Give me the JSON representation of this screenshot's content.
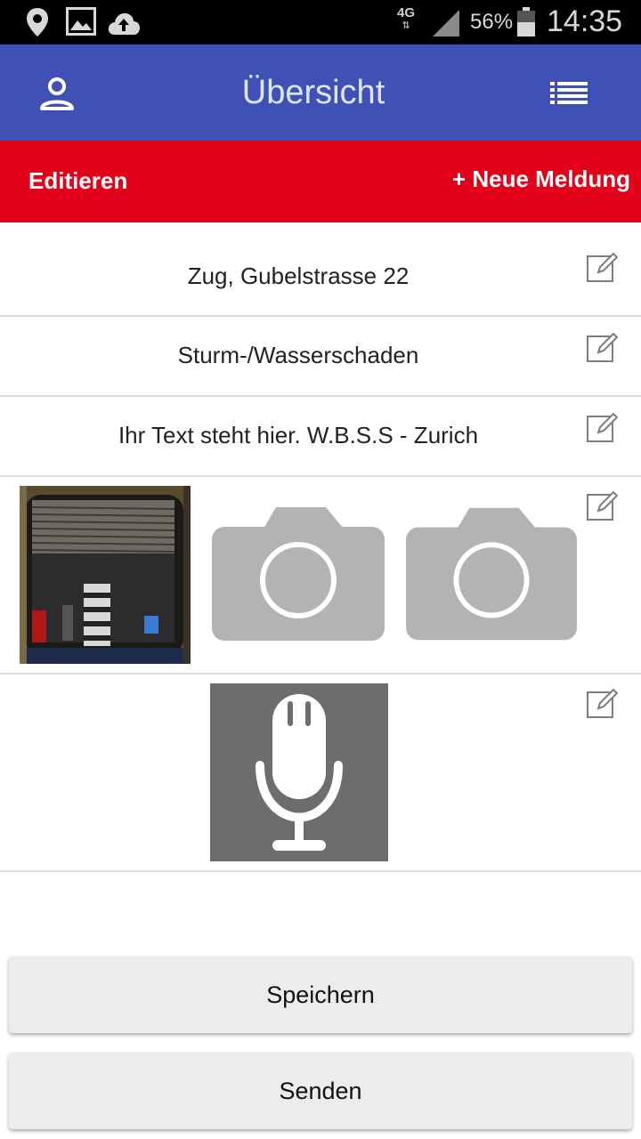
{
  "status_bar": {
    "network": "4G",
    "battery": "56%",
    "time": "14:35",
    "icons": [
      "location-pin-icon",
      "image-icon",
      "cloud-upload-icon",
      "signal-icon",
      "battery-icon"
    ]
  },
  "app_bar": {
    "title": "Übersicht",
    "left_icon": "profile-icon",
    "right_icon": "list-icon",
    "color": "#3f51b5"
  },
  "action_bar": {
    "edit_label": "Editieren",
    "new_label": "+ Neue Meldung",
    "color": "#e2001a"
  },
  "rows": {
    "location": "Zug, Gubelstrasse 22",
    "category": "Sturm-/Wasserschaden",
    "description": "Ihr Text steht hier. W.B.S.S - Zurich",
    "photos_icon": "camera-icon",
    "audio_icon": "microphone-icon"
  },
  "buttons": {
    "save": "Speichern",
    "send": "Senden"
  }
}
